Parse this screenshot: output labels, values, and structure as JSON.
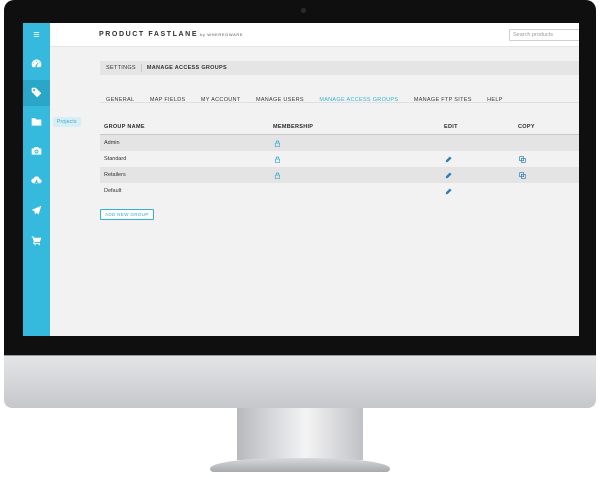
{
  "app": {
    "brand": "PRODUCT FASTLANE",
    "brand_by": "by WHEREOWARE",
    "search_placeholder": "Search products"
  },
  "sidebar": {
    "menu_glyph": "≡",
    "items": [
      {
        "icon": "dashboard-icon"
      },
      {
        "icon": "tag-icon",
        "active": true
      },
      {
        "icon": "folder-icon",
        "tooltip": "Projects"
      },
      {
        "icon": "camera-icon"
      },
      {
        "icon": "cloud-download-icon"
      },
      {
        "icon": "paper-plane-icon"
      },
      {
        "icon": "cart-icon"
      }
    ]
  },
  "breadcrumb": {
    "root": "SETTINGS",
    "current": "MANAGE ACCESS GROUPS"
  },
  "tabs": [
    {
      "label": "GENERAL"
    },
    {
      "label": "MAP FIELDS"
    },
    {
      "label": "MY ACCOUNT"
    },
    {
      "label": "MANAGE USERS"
    },
    {
      "label": "MANAGE ACCESS GROUPS",
      "active": true
    },
    {
      "label": "MANAGE FTP SITES"
    },
    {
      "label": "HELP"
    }
  ],
  "table": {
    "headers": [
      "GROUP NAME",
      "MEMBERSHIP",
      "EDIT",
      "COPY"
    ],
    "rows": [
      {
        "name": "Admin",
        "membership": true,
        "edit": false,
        "copy": false
      },
      {
        "name": "Standard",
        "membership": true,
        "edit": true,
        "copy": true
      },
      {
        "name": "Retailers",
        "membership": true,
        "edit": true,
        "copy": true
      },
      {
        "name": "Default",
        "membership": false,
        "edit": true,
        "copy": false
      }
    ]
  },
  "actions": {
    "add_group": "ADD NEW GROUP"
  },
  "colors": {
    "accent": "#35b9dd",
    "accent_dark": "#2aa6c9",
    "icon": "#35a7c9"
  }
}
